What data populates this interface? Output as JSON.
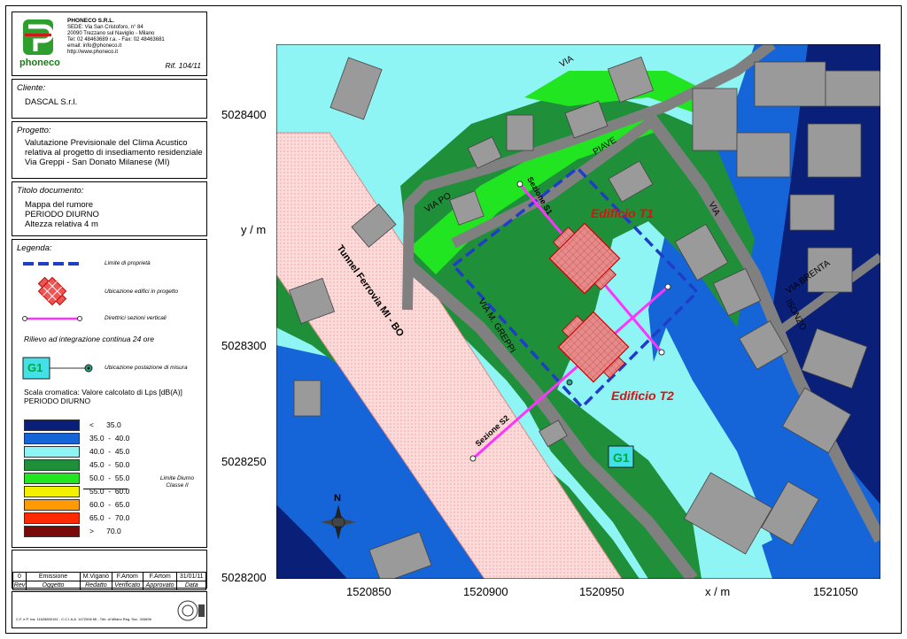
{
  "company": {
    "logo_text": "phoneco",
    "name": "PHONECO S.R.L.",
    "lines": [
      "SEDE: Via San Cristoforo, n° 84",
      "20090 Trezzano sul Naviglio - Milano",
      "Tel: 02 48463689 r.a. - Fax: 02 48463681",
      "email: info@phoneco.it",
      "http://www.phoneco.it"
    ],
    "ref": "Rif. 104/11"
  },
  "cliente": {
    "label": "Cliente:",
    "value": "DASCAL S.r.l."
  },
  "progetto": {
    "label": "Progetto:",
    "lines": [
      "Valutazione Previsionale del Clima Acustico",
      "relativa al progetto di insediamento residenziale",
      "Via Greppi - San Donato Milanese (MI)"
    ]
  },
  "titolo": {
    "label": "Titolo documento:",
    "lines": [
      "Mappa del rumore",
      "PERIODO DIURNO",
      "Altezza relativa 4 m"
    ]
  },
  "legenda": {
    "label": "Legenda:",
    "items": [
      "Limite di proprietà",
      "Ubicazione edifici in progetto",
      "Direttrici sezioni verticali"
    ],
    "rilievo": "Rilievo ad integrazione continua 24 ore",
    "g1": "G1",
    "g1_label": "Ubicazione postazione di misura",
    "scala_title": "Scala cromatica: Valore calcolato di Lps [dB(A)]",
    "scala_sub": "PERIODO DIURNO",
    "scale": [
      {
        "label": "<      35.0",
        "color": "#0a1f78"
      },
      {
        "label": "35.0  -  40.0",
        "color": "#1565d8"
      },
      {
        "label": "40.0  -  45.0",
        "color": "#8ff4f4"
      },
      {
        "label": "45.0  -  50.0",
        "color": "#1f8f3a"
      },
      {
        "label": "50.0  -  55.0",
        "color": "#22e522"
      },
      {
        "label": "55.0  -  60.0",
        "color": "#f2f200"
      },
      {
        "label": "60.0  -  65.0",
        "color": "#ff9a00"
      },
      {
        "label": "65.0  -  70.0",
        "color": "#ff2a00"
      },
      {
        "label": ">      70.0",
        "color": "#7a0a0a"
      }
    ],
    "limite": "Limite Diurno Classe II"
  },
  "revision": {
    "row": [
      "0",
      "Emissione",
      "M.Viganò",
      "F.Artom",
      "F.Artom",
      "31/01/11"
    ],
    "headers": [
      "Rev",
      "Oggetto",
      "Redatto",
      "Verificato",
      "Approvato",
      "Data"
    ]
  },
  "footer": {
    "text": "C.F. e P. Iva: 11628830151 - C.C.I.A.A. 1472006 MI - Trib. di Milano Reg. Soc. 334696"
  },
  "map": {
    "y_ticks": [
      "5028400",
      "y / m",
      "5028300",
      "5028250",
      "5028200"
    ],
    "x_ticks": [
      "1520850",
      "1520900",
      "1520950",
      "x / m",
      "1521050"
    ],
    "labels": {
      "via_po": "VIA      PO",
      "via_top": "VIA",
      "via_piave": "PIAVE",
      "via_greppi": "VIA    M.    GREPPI",
      "via_isonzo": "ISONZO",
      "via_right": "VIA",
      "via_brenta": "VIA  BRENTA",
      "tunnel": "Tunnel Ferrovia MI - BO",
      "edificio_t1": "Edificio T1",
      "edificio_t2": "Edificio T2",
      "sezione_s1": "Sezione S1",
      "sezione_s2": "Sezione S2",
      "g1": "G1",
      "north": "N"
    }
  }
}
